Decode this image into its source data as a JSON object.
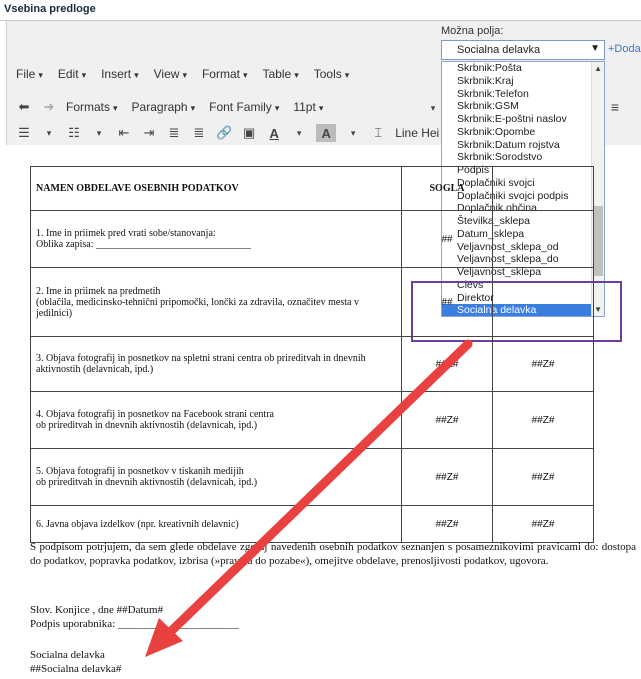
{
  "window": {
    "title": "Vsebina predloge"
  },
  "fields_panel": {
    "label": "Možna polja:",
    "selected": "Socialna delavka",
    "add_label": "+Doda",
    "options": [
      "Skrbnik:Pošta",
      "Skrbnik:Kraj",
      "Skrbnik:Telefon",
      "Skrbnik:GSM",
      "Skrbnik:E-poštni naslov",
      "Skrbnik:Opombe",
      "Skrbnik:Datum rojstva",
      "Skrbnik:Sorodstvo",
      "Podpis",
      "Doplačniki svojci",
      "Doplačniki svojci podpis",
      "Doplačnik občina",
      "Številka_sklepa",
      "Datum_sklepa",
      "Veljavnost_sklepa_od",
      "Veljavnost_sklepa_do",
      "Veljavnost_sklepa",
      "Clevs",
      "Direktor",
      "Socialna delavka"
    ],
    "highlight_color": "#6b3fa0",
    "selection_color": "#3a7ee0"
  },
  "menubar": [
    "File",
    "Edit",
    "Insert",
    "View",
    "Format",
    "Table",
    "Tools"
  ],
  "toolbar": {
    "formats": "Formats",
    "paragraph": "Paragraph",
    "font_family": "Font Family",
    "font_size": "11pt",
    "line_height": "Line Hei"
  },
  "document": {
    "table": {
      "header": [
        "NAMEN OBDELAVE OSEBNIH PODATKOV",
        "SOGLA",
        ""
      ],
      "rows": [
        {
          "line1": "1. Ime in priimek pred vrati sobe/stanovanja:",
          "line2": "Oblika zapisa: _______________________________",
          "v1": "##",
          "v2": ""
        },
        {
          "line1": "2. Ime in priimek na predmetih",
          "line2": "(oblačila, medicinsko-tehnični pripomočki, lončki za zdravila, označitev mesta v jedilnici)",
          "v1": "##",
          "v2": ""
        },
        {
          "line1": "3. Objava fotografij in posnetkov na spletni strani centra ob prireditvah in dnevnih aktivnostih (delavnicah, ipd.)",
          "line2": "",
          "v1": "##Z#",
          "v2": "##Z#"
        },
        {
          "line1": "4. Objava fotografij in posnetkov na Facebook strani centra",
          "line2": "ob prireditvah in dnevnih aktivnostih (delavnicah, ipd.)",
          "v1": "##Z#",
          "v2": "##Z#"
        },
        {
          "line1": "5. Objava fotografij in posnetkov v tiskanih medijih",
          "line2": "ob prireditvah in dnevnih aktivnostih (delavnicah, ipd.)",
          "v1": "##Z#",
          "v2": "##Z#"
        },
        {
          "line1": "6. Javna objava izdelkov (npr. kreativnih delavnic)",
          "line2": "",
          "v1": "##Z#",
          "v2": "##Z#"
        }
      ]
    },
    "consent_text": "S podpisom potrjujem, da sem glede obdelave zgoraj navedenih osebnih podatkov seznanjen s posameznikovimi pravicami do: dostopa do podatkov, popravka podatkov, izbrisa (»pravica do pozabe«), omejitve obdelave, prenosljivosti podatkov, ugovora.",
    "place_date": "Slov. Konjice , dne  ##Datum#",
    "signature": "Podpis uporabnika: ______________________",
    "role": "Socialna delavka",
    "role_field": "##Socialna delavka#"
  },
  "annotation": {
    "arrow_color": "#e8413f"
  }
}
